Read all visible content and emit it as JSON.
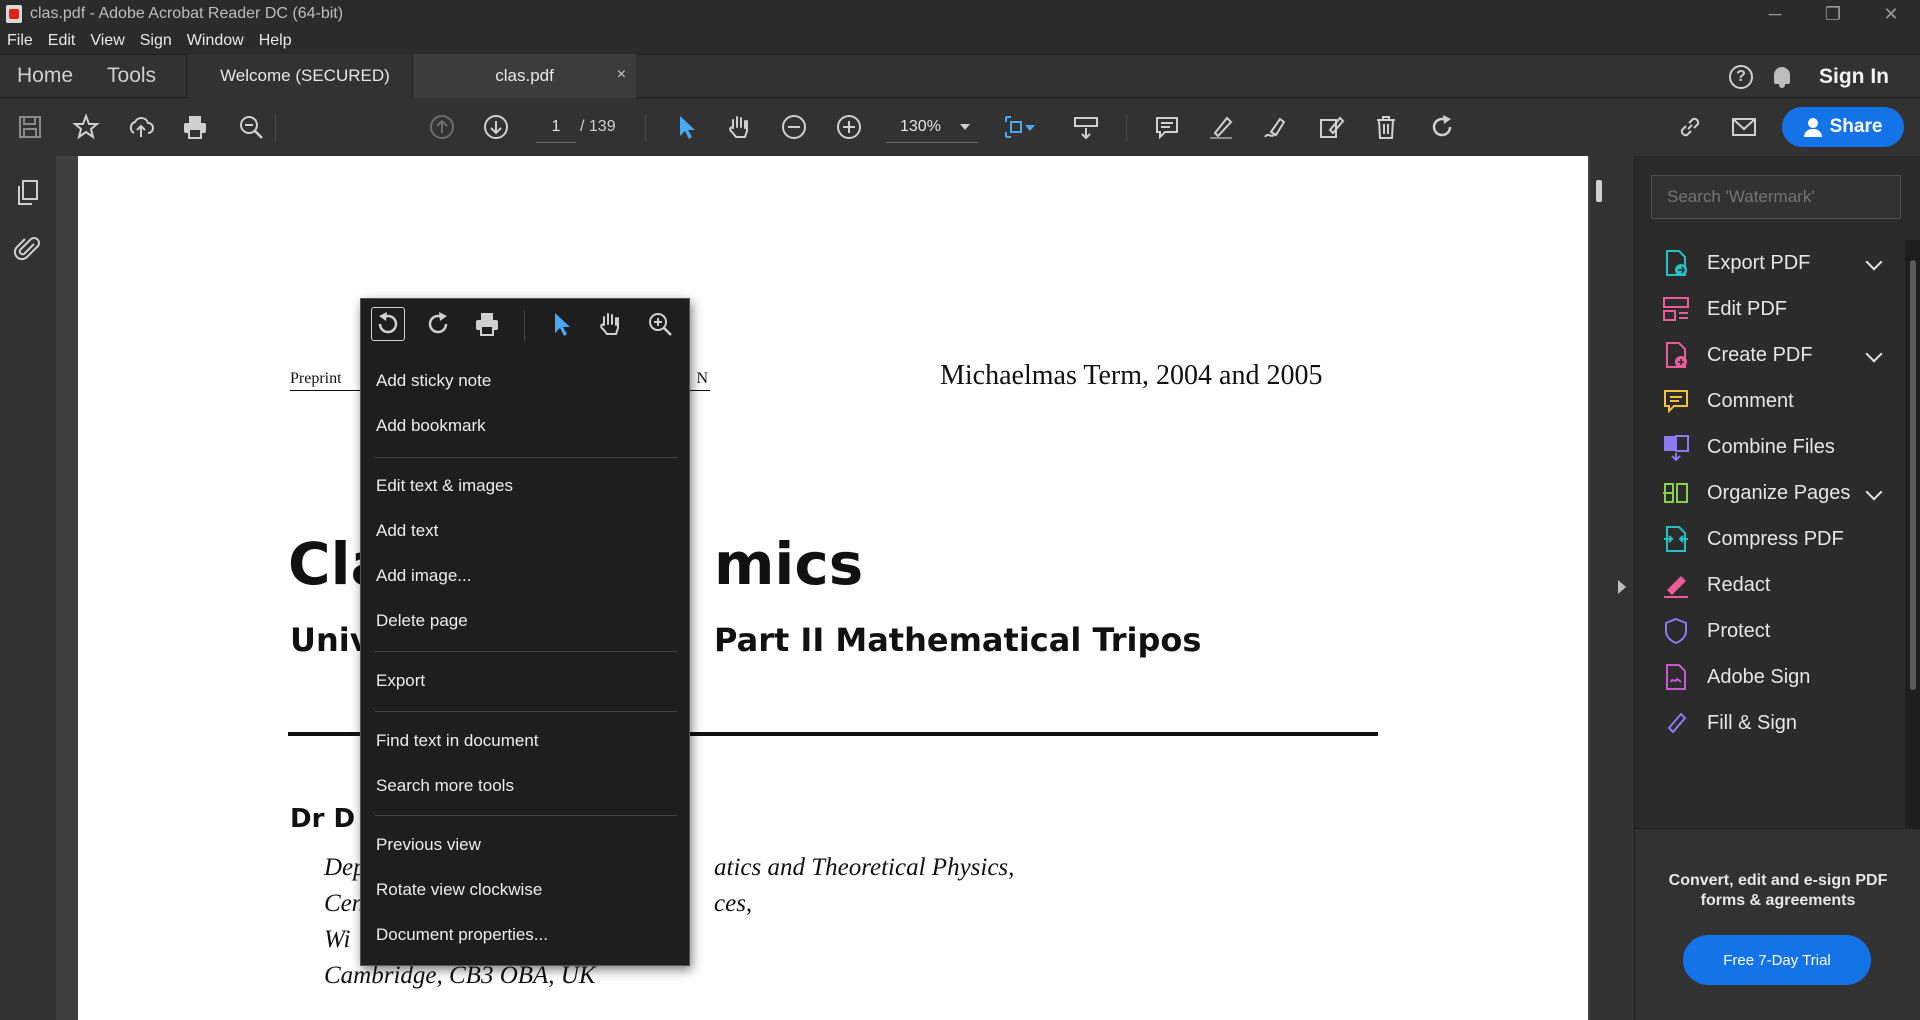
{
  "window": {
    "title": "clas.pdf - Adobe Acrobat Reader DC (64-bit)",
    "controls": [
      "─",
      "❐",
      "✕"
    ]
  },
  "menubar": [
    "File",
    "Edit",
    "View",
    "Sign",
    "Window",
    "Help"
  ],
  "tabs": {
    "home": "Home",
    "tools": "Tools",
    "welcome": "Welcome (SECURED)",
    "current": "clas.pdf",
    "close": "×",
    "help": "?",
    "signin": "Sign In"
  },
  "toolbar": {
    "page_current": "1",
    "page_total": "/  139",
    "zoom": "130%",
    "share": "Share"
  },
  "document": {
    "preprint": "Preprint",
    "preprint_suffix": "N",
    "term": "Michaelmas Term, 2004 and 2005",
    "title_visible": "Cla",
    "title_visible_right": "mics",
    "subtitle_left": "Univ",
    "subtitle_right": "Part II Mathematical Tripos",
    "author": "Dr D",
    "affiliation": [
      {
        "left": "Dep",
        "right": "atics and Theoretical Physics,"
      },
      {
        "left": "Cen",
        "right": "ces,"
      },
      {
        "left": "Wi",
        "right": ""
      },
      {
        "left": "Cambridge, CB3 OBA, UK",
        "right": ""
      }
    ]
  },
  "tools_pane": {
    "search_placeholder": "Search 'Watermark'",
    "items": [
      {
        "label": "Export PDF",
        "color": "#26c0c7",
        "expandable": true
      },
      {
        "label": "Edit PDF",
        "color": "#ec5b9a",
        "expandable": false
      },
      {
        "label": "Create PDF",
        "color": "#ec5b9a",
        "expandable": true
      },
      {
        "label": "Comment",
        "color": "#f5c33b",
        "expandable": false
      },
      {
        "label": "Combine Files",
        "color": "#8a7bf0",
        "expandable": false
      },
      {
        "label": "Organize Pages",
        "color": "#8ad14b",
        "expandable": true
      },
      {
        "label": "Compress PDF",
        "color": "#26c0c7",
        "expandable": false
      },
      {
        "label": "Redact",
        "color": "#ec5b9a",
        "expandable": false
      },
      {
        "label": "Protect",
        "color": "#8a7bf0",
        "expandable": false
      },
      {
        "label": "Adobe Sign",
        "color": "#c85ad6",
        "expandable": false
      },
      {
        "label": "Fill & Sign",
        "color": "#8a7bf0",
        "expandable": false
      }
    ],
    "promo_text": "Convert, edit and e-sign PDF forms & agreements",
    "trial_button": "Free 7-Day Trial"
  },
  "context_menu": {
    "items": [
      "Add sticky note",
      "Add bookmark",
      "Edit text & images",
      "Add text",
      "Add image...",
      "Delete page",
      "Export",
      "Find text in document",
      "Search more tools",
      "Previous view",
      "Rotate view clockwise",
      "Document properties..."
    ]
  },
  "colors": {
    "accent": "#1473e6",
    "select_tool": "#4aa8f0",
    "background": "#323232"
  }
}
